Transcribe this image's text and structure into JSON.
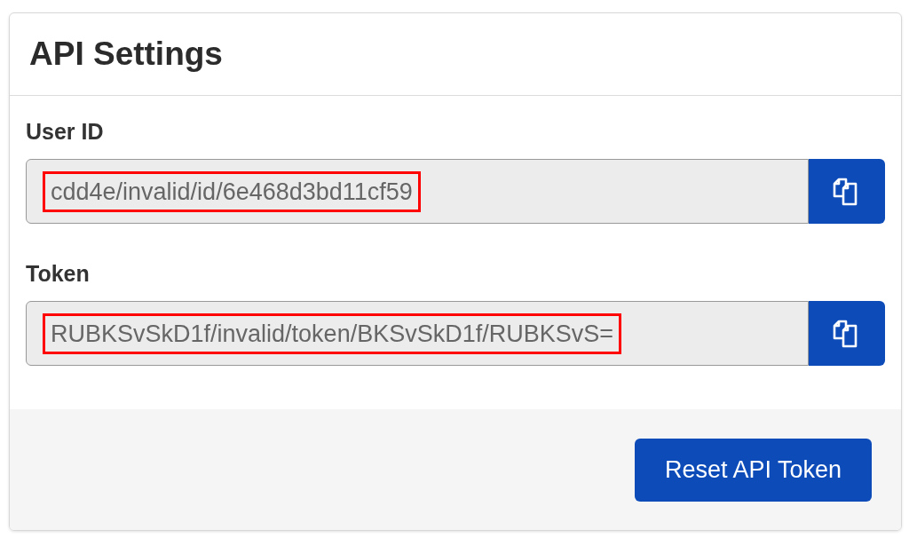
{
  "card": {
    "title": "API Settings"
  },
  "fields": [
    {
      "label": "User ID",
      "value": "cdd4e/invalid/id/6e468d3bd11cf59",
      "highlighted": true
    },
    {
      "label": "Token",
      "value": "RUBKSvSkD1f/invalid/token/BKSvSkD1f/RUBKSvS=",
      "highlighted": true
    }
  ],
  "footer": {
    "button": "Reset API Token"
  }
}
